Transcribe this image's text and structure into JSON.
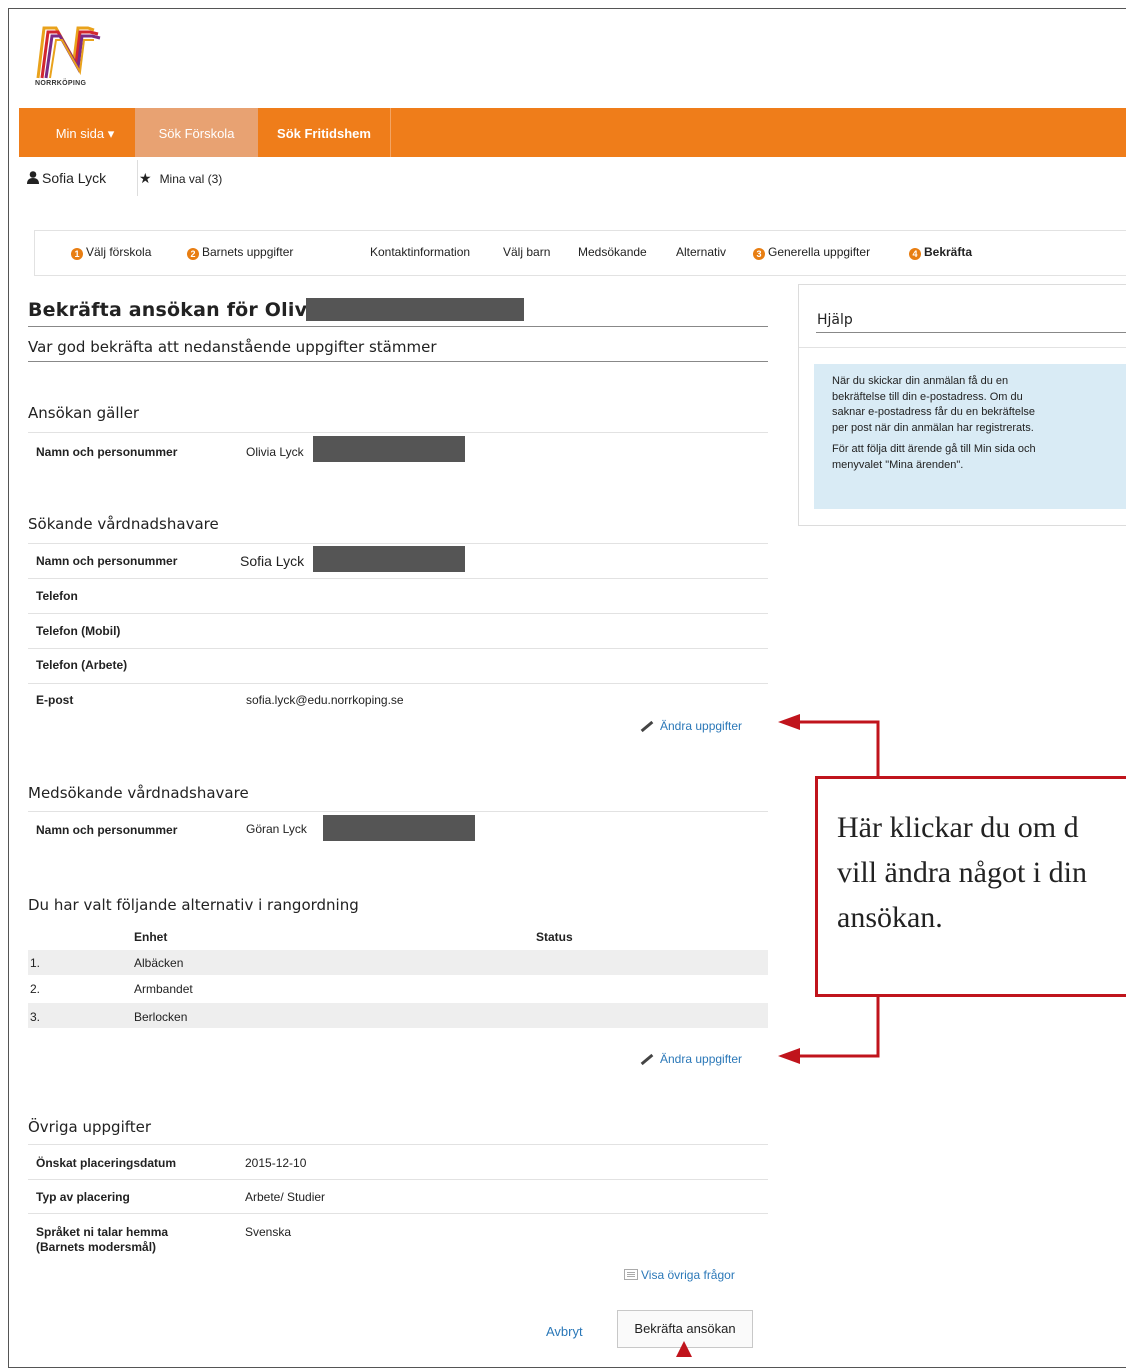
{
  "brand": {
    "logo_text": "NORRKÖPING"
  },
  "topnav": {
    "items": [
      {
        "label": "Min sida ▾"
      },
      {
        "label": "Sök Förskola"
      },
      {
        "label": "Sök Fritidshem"
      }
    ]
  },
  "userbar": {
    "user_name": "Sofia Lyck",
    "favorites_label": "Mina val (3)"
  },
  "steps": [
    {
      "num": "1",
      "label": "Välj förskola"
    },
    {
      "num": "2",
      "label": "Barnets uppgifter"
    },
    {
      "label": "Kontaktinformation"
    },
    {
      "label": "Välj barn"
    },
    {
      "label": "Medsökande"
    },
    {
      "label": "Alternativ"
    },
    {
      "num": "3",
      "label": "Generella uppgifter"
    },
    {
      "num": "4",
      "label": "Bekräfta"
    }
  ],
  "page": {
    "title": "Bekräfta ansökan för Olivia",
    "subtitle": "Var god bekräfta att nedanstående uppgifter stämmer"
  },
  "application": {
    "heading": "Ansökan gäller",
    "name_label": "Namn och personummer",
    "name_value": "Olivia Lyck"
  },
  "guardian": {
    "heading": "Sökande vårdnadshavare",
    "rows": [
      {
        "label": "Namn och personummer",
        "value": "Sofia Lyck"
      },
      {
        "label": "Telefon",
        "value": ""
      },
      {
        "label": "Telefon (Mobil)",
        "value": ""
      },
      {
        "label": "Telefon (Arbete)",
        "value": ""
      },
      {
        "label": "E-post",
        "value": "sofia.lyck@edu.norrkoping.se"
      }
    ],
    "edit_link": "Ändra uppgifter"
  },
  "co_guardian": {
    "heading": "Medsökande vårdnadshavare",
    "name_label": "Namn och personummer",
    "name_value": "Göran Lyck"
  },
  "alternatives": {
    "heading": "Du har valt följande alternativ i rangordning",
    "columns": [
      "Enhet",
      "Status"
    ],
    "rows": [
      {
        "rank": "1.",
        "unit": "Albäcken"
      },
      {
        "rank": "2.",
        "unit": "Armbandet"
      },
      {
        "rank": "3.",
        "unit": "Berlocken"
      }
    ],
    "edit_link": "Ändra uppgifter"
  },
  "other": {
    "heading": "Övriga uppgifter",
    "rows": [
      {
        "label": "Önskat placeringsdatum",
        "value": "2015-12-10"
      },
      {
        "label": "Typ av placering",
        "value": "Arbete/ Studier"
      },
      {
        "label": "Språket ni talar hemma",
        "label2": "(Barnets modersmål)",
        "value": "Svenska"
      }
    ],
    "more_link": "Visa övriga frågor"
  },
  "actions": {
    "cancel": "Avbryt",
    "confirm": "Bekräfta ansökan"
  },
  "help": {
    "title": "Hjälp",
    "paragraphs": [
      [
        "När du skickar din anmälan få du en",
        "bekräftelse till din e-postadress. Om du",
        "saknar e-postadress får du en bekräftelse",
        "per post när din anmälan har registrerats."
      ],
      [
        "För att följa ditt ärende gå till Min sida och",
        "menyvalet \"Mina ärenden\"."
      ]
    ]
  },
  "annotation": {
    "lines": [
      "Här klickar du om d",
      "vill ändra något i din",
      "ansökan."
    ],
    "color": "#c0141c"
  },
  "colors": {
    "nav_orange": "#ef7d1a",
    "nav_active": "#e8a272",
    "link_blue": "#2b78b8",
    "info_bg": "#d9ebf5",
    "annotation_red": "#c0141c"
  }
}
